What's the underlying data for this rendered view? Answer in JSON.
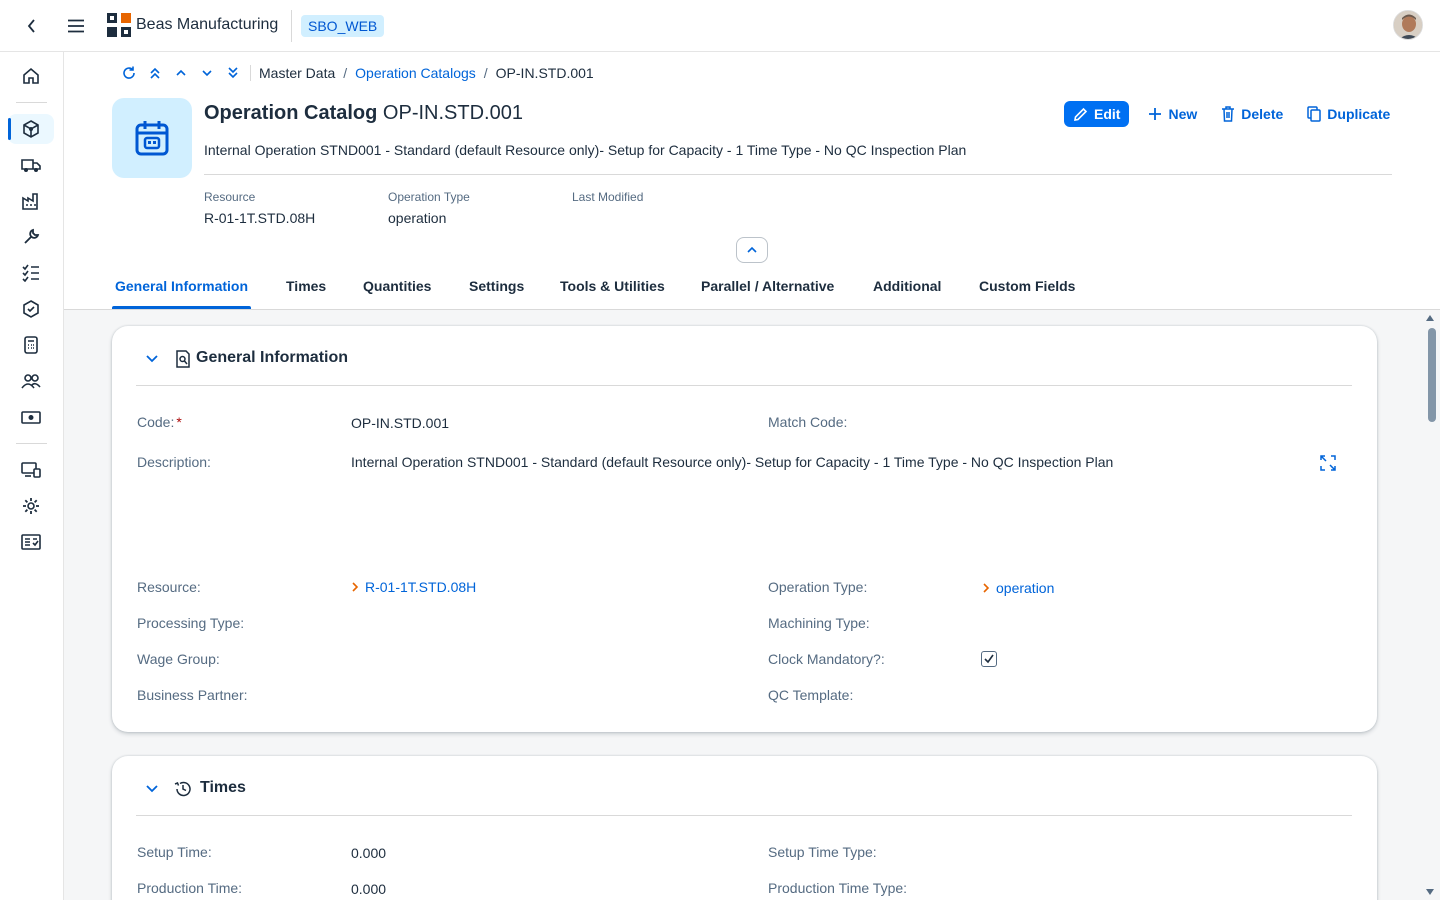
{
  "shell": {
    "brand": "Beas Manufacturing",
    "system": "SBO_WEB"
  },
  "breadcrumb": {
    "items": [
      "Master Data",
      "Operation Catalogs",
      "OP-IN.STD.001"
    ]
  },
  "header": {
    "title_bold": "Operation Catalog",
    "title_id": "OP-IN.STD.001",
    "subtitle": "Internal Operation STND001 - Standard (default Resource only)- Setup for Capacity - 1 Time Type - No QC Inspection Plan",
    "actions": {
      "edit": "Edit",
      "new": "New",
      "delete": "Delete",
      "duplicate": "Duplicate"
    },
    "attributes": [
      {
        "label": "Resource",
        "value": "R-01-1T.STD.08H"
      },
      {
        "label": "Operation Type",
        "value": "operation"
      },
      {
        "label": "Last Modified",
        "value": ""
      }
    ]
  },
  "tabs": [
    {
      "label": "General Information",
      "active": true
    },
    {
      "label": "Times"
    },
    {
      "label": "Quantities"
    },
    {
      "label": "Settings"
    },
    {
      "label": "Tools & Utilities"
    },
    {
      "label": "Parallel / Alternative"
    },
    {
      "label": "Additional"
    },
    {
      "label": "Custom Fields"
    }
  ],
  "general": {
    "title": "General Information",
    "code_label": "Code:",
    "code_required": "*",
    "code_value": "OP-IN.STD.001",
    "match_code_label": "Match Code:",
    "description_label": "Description:",
    "description_value": "Internal Operation STND001 - Standard (default Resource only)- Setup for Capacity - 1 Time Type - No QC Inspection Plan",
    "resource_label": "Resource:",
    "resource_value": "R-01-1T.STD.08H",
    "operation_type_label": "Operation Type:",
    "operation_type_value": "operation",
    "processing_type_label": "Processing Type:",
    "machining_type_label": "Machining Type:",
    "wage_group_label": "Wage Group:",
    "clock_mandatory_label": "Clock Mandatory?:",
    "clock_mandatory_checked": true,
    "business_partner_label": "Business Partner:",
    "qc_template_label": "QC Template:"
  },
  "times": {
    "title": "Times",
    "setup_time_label": "Setup Time:",
    "setup_time_value": "0.000",
    "setup_time_type_label": "Setup Time Type:",
    "production_time_label": "Production Time:",
    "production_time_value": "0.000",
    "production_time_type_label": "Production Time Type:"
  },
  "colors": {
    "accent": "#0064d9",
    "emphasized": "#0070f2",
    "text": "#1d2d3e",
    "label": "#556b82",
    "link_chevron": "#e76500"
  }
}
